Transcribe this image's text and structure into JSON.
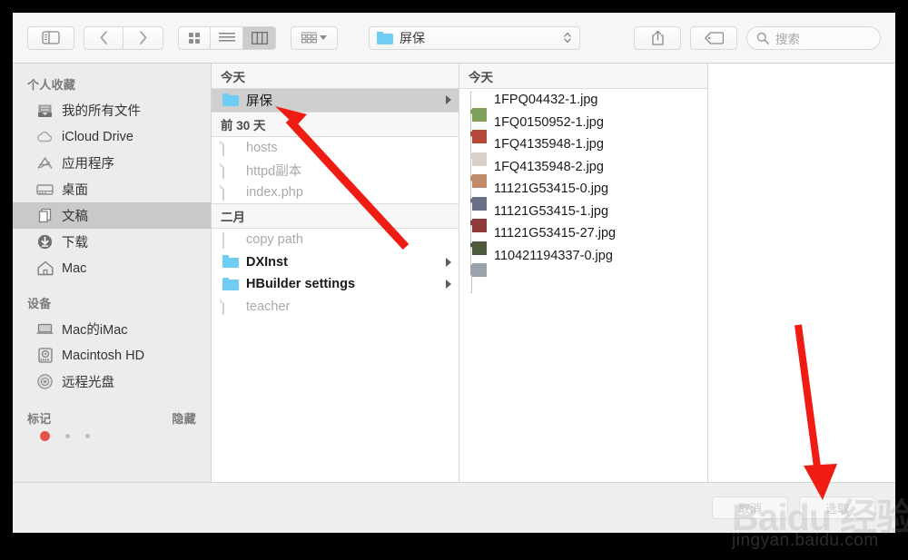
{
  "toolbar": {
    "sidebar_toggle": "sidebar-toggle",
    "back": "back",
    "forward": "forward",
    "view_icon": "icon-view",
    "view_list": "list-view",
    "view_column": "column-view",
    "arrange": "arrange",
    "path_label": "屏保",
    "share": "share",
    "tags": "tags",
    "search_placeholder": "搜索"
  },
  "sidebar": {
    "favorites_header": "个人收藏",
    "favorites": [
      {
        "label": "我的所有文件",
        "icon": "all-files-icon",
        "selected": false
      },
      {
        "label": "iCloud Drive",
        "icon": "cloud-icon",
        "selected": false
      },
      {
        "label": "应用程序",
        "icon": "applications-icon",
        "selected": false
      },
      {
        "label": "桌面",
        "icon": "desktop-icon",
        "selected": false
      },
      {
        "label": "文稿",
        "icon": "documents-icon",
        "selected": true
      },
      {
        "label": "下载",
        "icon": "downloads-icon",
        "selected": false
      },
      {
        "label": "Mac",
        "icon": "home-icon",
        "selected": false
      }
    ],
    "devices_header": "设备",
    "devices": [
      {
        "label": "Mac的iMac",
        "icon": "laptop-icon"
      },
      {
        "label": "Macintosh HD",
        "icon": "harddisk-icon"
      },
      {
        "label": "远程光盘",
        "icon": "disc-icon"
      }
    ],
    "tags_header": "标记",
    "tags_hide": "隐藏"
  },
  "column1": {
    "groups": [
      {
        "title": "今天",
        "items": [
          {
            "name": "屏保",
            "type": "folder",
            "selected": true,
            "expandable": true,
            "dim": false
          }
        ]
      },
      {
        "title": "前 30 天",
        "items": [
          {
            "name": "hosts",
            "type": "doc",
            "selected": false,
            "expandable": false,
            "dim": true
          },
          {
            "name": "httpd副本",
            "type": "doc",
            "selected": false,
            "expandable": false,
            "dim": true
          },
          {
            "name": "index.php",
            "type": "doc",
            "selected": false,
            "expandable": false,
            "dim": true
          }
        ]
      },
      {
        "title": "二月",
        "items": [
          {
            "name": "copy path",
            "type": "pill",
            "selected": false,
            "expandable": false,
            "dim": true
          },
          {
            "name": "DXInst",
            "type": "folder",
            "selected": false,
            "expandable": true,
            "dim": false
          },
          {
            "name": "HBuilder settings",
            "type": "folder",
            "selected": false,
            "expandable": true,
            "dim": false
          },
          {
            "name": "teacher",
            "type": "doc",
            "selected": false,
            "expandable": false,
            "dim": true
          }
        ]
      }
    ]
  },
  "column2": {
    "group_title": "今天",
    "files": [
      {
        "name": "1FPQ04432-1.jpg",
        "thumb": "#7fa05a"
      },
      {
        "name": "1FQ0150952-1.jpg",
        "thumb": "#b4493a"
      },
      {
        "name": "1FQ4135948-1.jpg",
        "thumb": "#d9d2cc"
      },
      {
        "name": "1FQ4135948-2.jpg",
        "thumb": "#c08a6a"
      },
      {
        "name": "11121G53415-0.jpg",
        "thumb": "#6b6f86"
      },
      {
        "name": "11121G53415-1.jpg",
        "thumb": "#8e3a38"
      },
      {
        "name": "11121G53415-27.jpg",
        "thumb": "#4f5b3c"
      },
      {
        "name": "110421194337-0.jpg",
        "thumb": "#9aa3ab"
      }
    ]
  },
  "bottom": {
    "cancel": "取消",
    "choose": "选取"
  },
  "watermark": {
    "line1": "Baidu 经验",
    "line2": "jingyan.baidu.com"
  },
  "colors": {
    "folder_blue": "#6fcdf3",
    "selection_gray": "#cfcfcf",
    "arrow_red": "#ee1c12"
  }
}
